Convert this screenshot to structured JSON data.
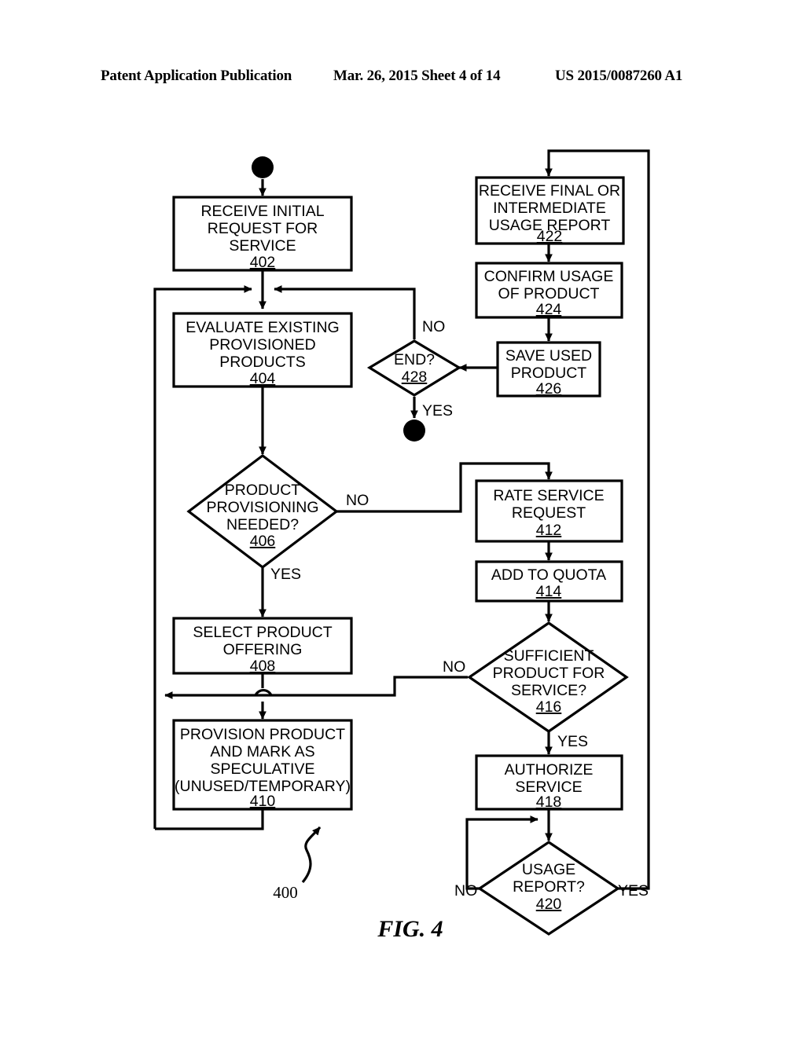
{
  "header": {
    "left": "Patent Application Publication",
    "middle": "Mar. 26, 2015  Sheet 4 of 14",
    "right": "US 2015/0087260 A1"
  },
  "figure": {
    "caption": "FIG. 4",
    "lead_number": "400"
  },
  "nodes": {
    "start": {
      "type": "terminator-filled",
      "name": "start-node"
    },
    "end": {
      "type": "terminator-filled",
      "name": "end-node"
    },
    "n402": {
      "type": "process",
      "lines": [
        "RECEIVE INITIAL",
        "REQUEST FOR",
        "SERVICE"
      ],
      "ref": "402"
    },
    "n404": {
      "type": "process",
      "lines": [
        "EVALUATE EXISTING",
        "PROVISIONED",
        "PRODUCTS"
      ],
      "ref": "404"
    },
    "n406": {
      "type": "decision",
      "lines": [
        "PRODUCT",
        "PROVISIONING",
        "NEEDED?"
      ],
      "ref": "406"
    },
    "n408": {
      "type": "process",
      "lines": [
        "SELECT PRODUCT",
        "OFFERING"
      ],
      "ref": "408"
    },
    "n410": {
      "type": "process",
      "lines": [
        "PROVISION PRODUCT",
        "AND MARK AS",
        "SPECULATIVE",
        "(UNUSED/TEMPORARY)"
      ],
      "ref": "410"
    },
    "n412": {
      "type": "process",
      "lines": [
        "RATE SERVICE",
        "REQUEST"
      ],
      "ref": "412"
    },
    "n414": {
      "type": "process",
      "lines": [
        "ADD TO QUOTA"
      ],
      "ref": "414"
    },
    "n416": {
      "type": "decision",
      "lines": [
        "SUFFICIENT",
        "PRODUCT FOR",
        "SERVICE?"
      ],
      "ref": "416"
    },
    "n418": {
      "type": "process",
      "lines": [
        "AUTHORIZE",
        "SERVICE"
      ],
      "ref": "418"
    },
    "n420": {
      "type": "decision",
      "lines": [
        "USAGE",
        "REPORT?"
      ],
      "ref": "420"
    },
    "n422": {
      "type": "process",
      "lines": [
        "RECEIVE FINAL OR",
        "INTERMEDIATE",
        "USAGE REPORT"
      ],
      "ref": "422"
    },
    "n424": {
      "type": "process",
      "lines": [
        "CONFIRM USAGE",
        "OF PRODUCT"
      ],
      "ref": "424"
    },
    "n426": {
      "type": "process",
      "lines": [
        "SAVE USED",
        "PRODUCT"
      ],
      "ref": "426"
    },
    "n428": {
      "type": "decision",
      "lines": [
        "END?"
      ],
      "ref": "428"
    }
  },
  "edge_labels": {
    "e406_no": "NO",
    "e406_yes": "YES",
    "e416_no": "NO",
    "e416_yes": "YES",
    "e420_no": "NO",
    "e420_yes": "YES",
    "e428_no": "NO",
    "e428_yes": "YES"
  },
  "colors": {
    "ink": "#000000",
    "paper": "#ffffff"
  }
}
